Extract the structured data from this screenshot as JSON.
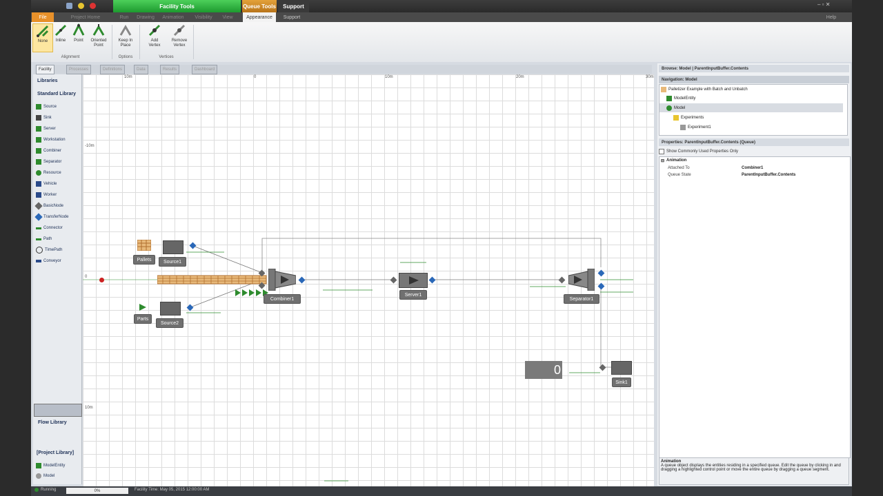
{
  "window": {
    "contextual_tabs": [
      "Facility Tools",
      "Queue Tools",
      "Support"
    ],
    "ribbon_tabs": [
      "File",
      "Project Home",
      "Run",
      "Drawing",
      "Animation",
      "Visibility",
      "View",
      "Appearance",
      "Support",
      "Help"
    ]
  },
  "ribbon": {
    "alignment": {
      "label": "Alignment",
      "buttons": [
        "None",
        "Inline",
        "Point",
        "Oriented Point"
      ]
    },
    "options": {
      "label": "Options",
      "buttons": [
        "Keep In Place"
      ]
    },
    "vertices": {
      "label": "Vertices",
      "buttons": [
        "Add Vertex",
        "Remove Vertex"
      ]
    }
  },
  "view_tabs": [
    "Facility",
    "Processes",
    "Definitions",
    "Data",
    "Results",
    "Dashboard"
  ],
  "library": {
    "libraries_label": "Libraries",
    "standard_label": "Standard Library",
    "items": [
      "Source",
      "Sink",
      "Server",
      "Workstation",
      "Combiner",
      "Separator",
      "Resource",
      "Vehicle",
      "Worker",
      "BasicNode",
      "TransferNode",
      "Connector",
      "Path",
      "TimePath",
      "Conveyor"
    ],
    "flow_label": "Flow Library",
    "project_label": "[Project Library]",
    "project_items": [
      "ModelEntity",
      "Model"
    ]
  },
  "canvas": {
    "ruler": [
      "10m",
      "0",
      "10m",
      "20m",
      "30m"
    ],
    "ruler_y": [
      "-10m",
      "0",
      "10m"
    ],
    "objects": {
      "pallets": "Pallets",
      "source1": "Source1",
      "parts": "Parts",
      "source2": "Source2",
      "combiner1": "Combiner1",
      "server1": "Server1",
      "separator1": "Separator1",
      "sink1": "Sink1",
      "status_value": "0"
    }
  },
  "browse": {
    "header": "Browse: Model | ParentInputBuffer.Contents",
    "nav_label": "Navigation: Model",
    "tree": [
      "Palletizer Example with Batch and Unbatch",
      "ModelEntity",
      "Model",
      "Experiments",
      "Experiment1"
    ]
  },
  "properties": {
    "header": "Properties: ParentInputBuffer.Contents (Queue)",
    "checkbox": "Show Commonly Used Properties Only",
    "section": "Animation",
    "rows": [
      {
        "name": "Attached To",
        "value": "Combiner1"
      },
      {
        "name": "Queue State",
        "value": "ParentInputBuffer.Contents"
      }
    ],
    "help_title": "Animation",
    "help_text": "A queue object displays the entities residing in a specified queue. Edit the queue by clicking in and dragging a highlighted control point or move the entire queue by dragging a queue segment."
  },
  "status": {
    "run": "Running",
    "progress": "0%",
    "time": "Facility Time: May 05, 2015 12:00:00 AM"
  },
  "colors": {
    "accent": "#2e8b2e",
    "ribbon_context": "#26a83a",
    "queue": "#c98a4a"
  }
}
